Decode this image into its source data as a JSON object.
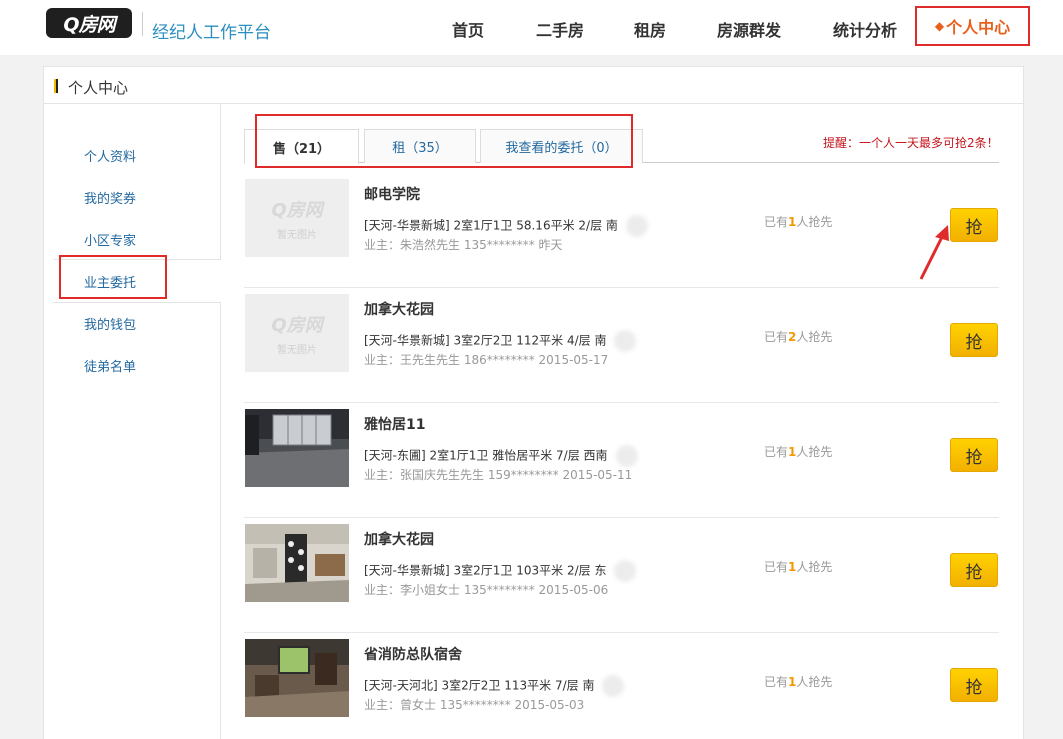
{
  "header": {
    "logo_text": "Q房网",
    "platform_title": "经纪人工作平台",
    "nav": {
      "home": "首页",
      "used": "二手房",
      "rent": "租房",
      "publish": "房源群发",
      "stats": "统计分析",
      "me": "个人中心"
    }
  },
  "panel": {
    "title": "个人中心"
  },
  "sidebar": {
    "items": [
      "个人资料",
      "我的奖券",
      "小区专家",
      "业主委托",
      "我的钱包",
      "徒弟名单"
    ]
  },
  "tabs": [
    {
      "label": "售（21）",
      "active": true
    },
    {
      "label": "租（35）",
      "active": false
    },
    {
      "label": "我查看的委托（0）",
      "active": false
    }
  ],
  "reminder": "提醒：一个人一天最多可抢2条！",
  "placeholder": {
    "logo": "Q房网",
    "text": "暂无图片"
  },
  "listings": [
    {
      "name": "邮电学院",
      "info": "[天河-华景新城]   2室1厅1卫    58.16平米    2/层    南",
      "owner": "业主：朱浩然先生   135********  昨天",
      "grab_prefix": "已有",
      "grab_num": "1",
      "grab_suffix": "人抢先",
      "button": "抢",
      "has_photo": false
    },
    {
      "name": "加拿大花园",
      "info": "[天河-华景新城]   3室2厅2卫    112平米    4/层    南",
      "owner": "业主：王先生先生   186********  2015-05-17",
      "grab_prefix": "已有",
      "grab_num": "2",
      "grab_suffix": "人抢先",
      "button": "抢",
      "has_photo": false
    },
    {
      "name": "雅怡居11",
      "info": "[天河-东圃]   2室1厅1卫    雅怡居平米    7/层    西南",
      "owner": "业主：张国庆先生先生   159********  2015-05-11",
      "grab_prefix": "已有",
      "grab_num": "1",
      "grab_suffix": "人抢先",
      "button": "抢",
      "has_photo": true
    },
    {
      "name": "加拿大花园",
      "info": "[天河-华景新城]   3室2厅1卫    103平米    2/层    东",
      "owner": "业主：李小姐女士   135********  2015-05-06",
      "grab_prefix": "已有",
      "grab_num": "1",
      "grab_suffix": "人抢先",
      "button": "抢",
      "has_photo": true
    },
    {
      "name": "省消防总队宿舍",
      "info": "[天河-天河北]   3室2厅2卫    113平米    7/层    南",
      "owner": "业主：曾女士   135********  2015-05-03",
      "grab_prefix": "已有",
      "grab_num": "1",
      "grab_suffix": "人抢先",
      "button": "抢",
      "has_photo": true
    }
  ]
}
